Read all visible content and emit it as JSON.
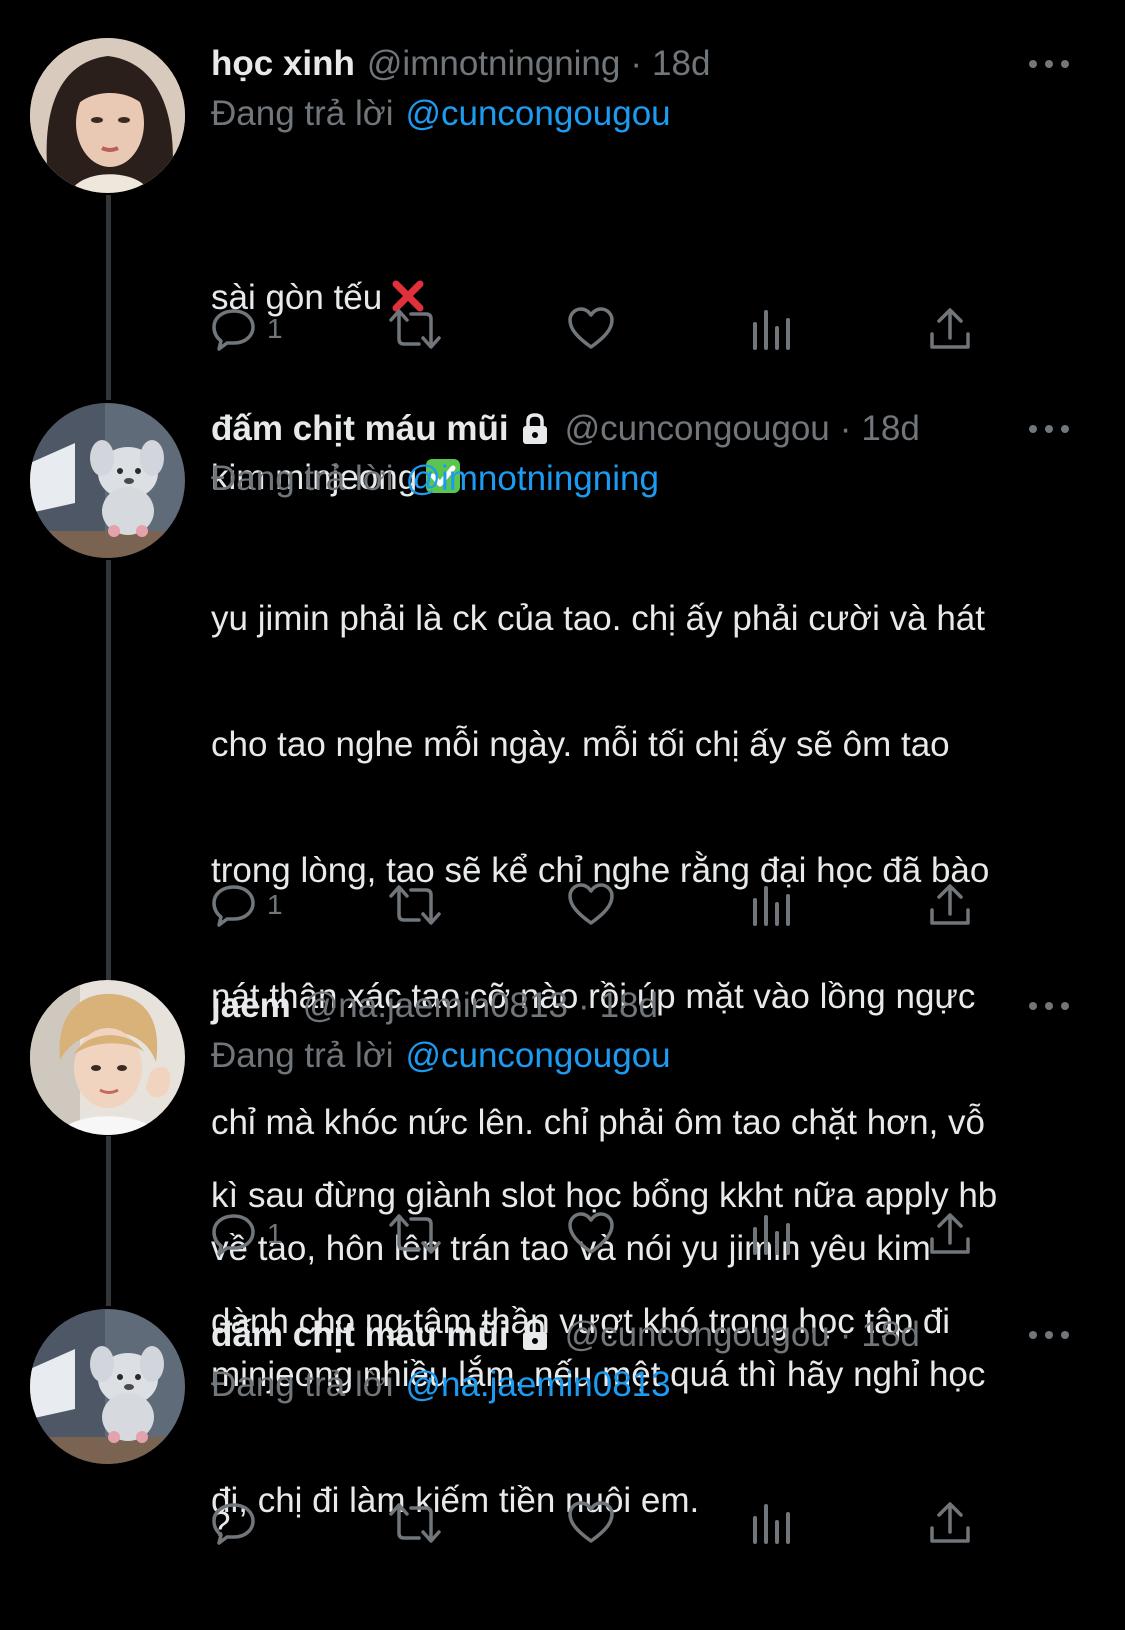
{
  "tweets": [
    {
      "display_name": "học xinh",
      "handle": "@imnotningning",
      "time": "18d",
      "locked": false,
      "reply_prefix": "Đang trả lời",
      "reply_to": "@cuncongougou",
      "body_lines": [
        "sài gòn tếu",
        "kim minjeong"
      ],
      "reply_count": "1",
      "avatar": "girl-portrait"
    },
    {
      "display_name": "đấm chịt máu mũi",
      "handle": "@cuncongougou",
      "time": "18d",
      "locked": true,
      "reply_prefix": "Đang trả lời",
      "reply_to": "@imnotningning",
      "body_lines": [
        "yu jimin phải là ck của tao. chị ấy phải cười và hát",
        "cho tao nghe mỗi ngày. mỗi tối chị ấy sẽ ôm tao",
        "trong lòng, tao sẽ kể chỉ nghe rằng đại học đã bào",
        "nát thân xác tao cỡ nào rồi úp mặt vào lồng ngực",
        "chỉ mà khóc nức lên. chỉ phải ôm tao chặt hơn, vỗ",
        "về tao, hôn lên trán tao và nói yu jimin yêu kim",
        "minjeong nhiều lắm, nếu mệt quá thì hãy nghỉ học",
        "đi, chị đi làm kiếm tiền nuôi em."
      ],
      "reply_count": "1",
      "avatar": "plush-toy"
    },
    {
      "display_name": "jaem",
      "handle": "@na.jaemin0813",
      "time": "18d",
      "locked": false,
      "reply_prefix": "Đang trả lời",
      "reply_to": "@cuncongougou",
      "body_lines": [
        "kì sau đừng giành slot học bổng kkht nữa apply hb",
        "dành cho ng tâm thần vượt khó trong học tập đi"
      ],
      "reply_count": "1",
      "avatar": "boy-portrait"
    },
    {
      "display_name": "đấm chịt máu mũi",
      "handle": "@cuncongougou",
      "time": "18d",
      "locked": true,
      "reply_prefix": "Đang trả lời",
      "reply_to": "@na.jaemin0813",
      "body_lines": [
        "?"
      ],
      "reply_count": "",
      "avatar": "plush-toy"
    }
  ],
  "emojis": {
    "tweet0_line0": "cross-mark-emoji",
    "tweet0_line1": "check-mark-emoji"
  },
  "colors": {
    "background": "#000000",
    "text": "#e7e9ea",
    "secondary": "#71767b",
    "link": "#1d9bf0",
    "thread_line": "#333639"
  }
}
